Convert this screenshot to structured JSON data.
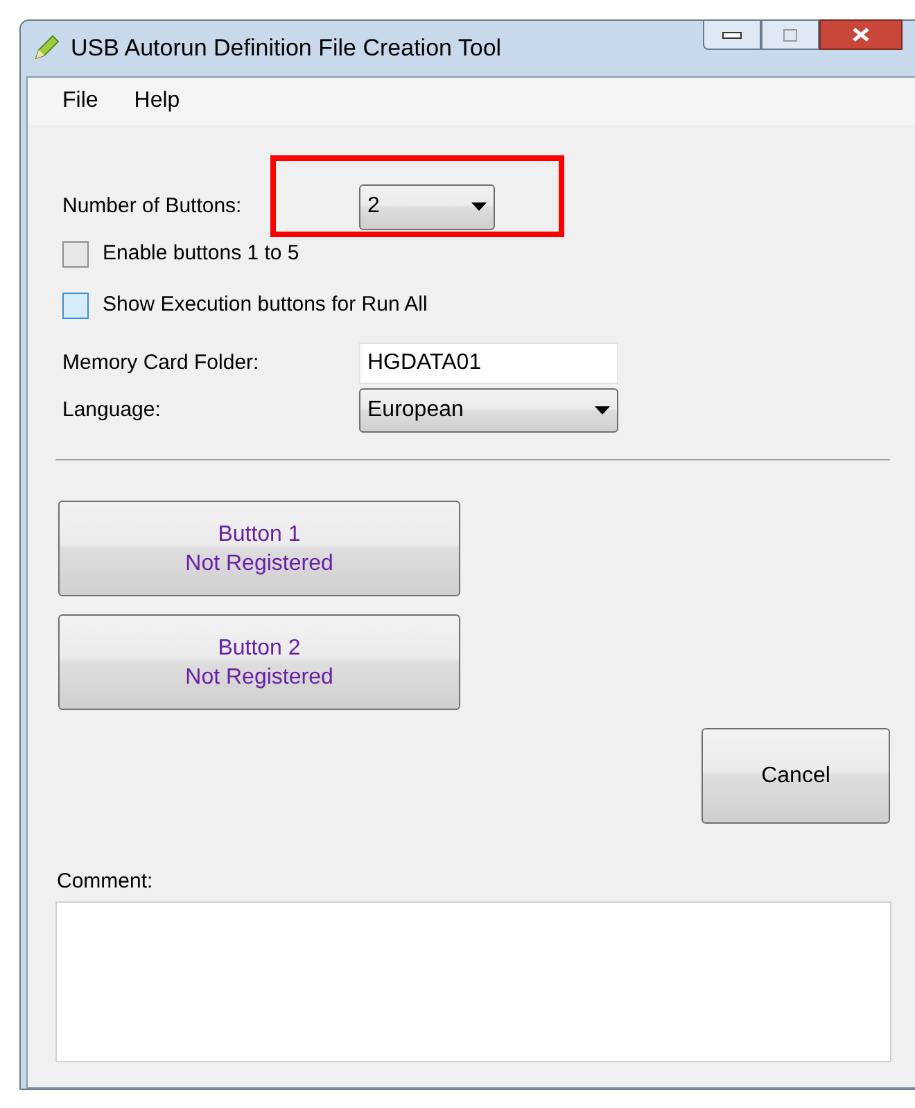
{
  "window": {
    "title": "USB Autorun Definition File Creation Tool"
  },
  "menu": [
    "File",
    "Help"
  ],
  "number_of_buttons": {
    "label": "Number of Buttons:",
    "value": "2",
    "highlighted": true
  },
  "checkboxes": [
    {
      "label": "Enable buttons 1 to 5",
      "checked": false,
      "hovered": false
    },
    {
      "label": "Show Execution buttons for Run All",
      "checked": false,
      "hovered": true
    }
  ],
  "memory_card_folder": {
    "label": "Memory Card Folder:",
    "value": "HGDATA01"
  },
  "language": {
    "label": "Language:",
    "value": "European"
  },
  "action_buttons": [
    {
      "title": "Button 1",
      "status": "Not Registered"
    },
    {
      "title": "Button 2",
      "status": "Not Registered"
    }
  ],
  "cancel_button": "Cancel",
  "comment": {
    "label": "Comment:"
  }
}
